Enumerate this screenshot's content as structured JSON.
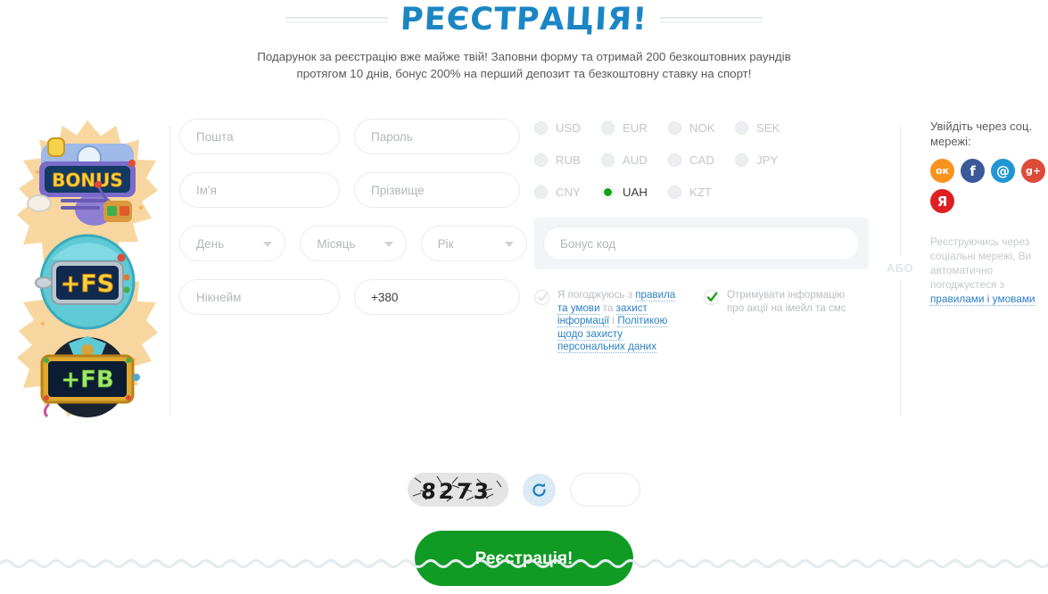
{
  "header": {
    "title": "РЕЄСТРАЦІЯ!",
    "subtitle": "Подарунок за реєстрацію вже майже твій! Заповни форму та отримай 200 безкоштовних раундів протягом 10 днів, бонус 200% на перший депозит та безкоштовну ставку на спорт!"
  },
  "promo": {
    "badges": [
      {
        "label": "BONUS"
      },
      {
        "label": "+FS"
      },
      {
        "label": "+FB"
      }
    ]
  },
  "form": {
    "email_placeholder": "Пошта",
    "password_placeholder": "Пароль",
    "firstname_placeholder": "Ім'я",
    "lastname_placeholder": "Прізвище",
    "day_placeholder": "День",
    "month_placeholder": "Місяць",
    "year_placeholder": "Рік",
    "nickname_placeholder": "Нікнейм",
    "phone_value": "+380"
  },
  "currency": {
    "rows": [
      [
        {
          "code": "USD",
          "selected": false
        },
        {
          "code": "EUR",
          "selected": false
        },
        {
          "code": "NOK",
          "selected": false
        },
        {
          "code": "SEK",
          "selected": false
        }
      ],
      [
        {
          "code": "RUB",
          "selected": false
        },
        {
          "code": "AUD",
          "selected": false
        },
        {
          "code": "CAD",
          "selected": false
        },
        {
          "code": "JPY",
          "selected": false
        }
      ],
      [
        {
          "code": "CNY",
          "selected": false
        },
        {
          "code": "UAH",
          "selected": true
        },
        {
          "code": "KZT",
          "selected": false
        }
      ]
    ],
    "selected": "UAH",
    "selected_color": "#14a014"
  },
  "bonus": {
    "placeholder": "Бонус код"
  },
  "agreements": [
    {
      "checked": false,
      "parts": [
        {
          "text": "Я погоджуюсь з ",
          "link": false
        },
        {
          "text": "правила та умови",
          "link": true
        },
        {
          "text": " та ",
          "link": false
        },
        {
          "text": "захист інформації",
          "link": true
        },
        {
          "text": " і ",
          "link": false
        },
        {
          "text": "Політикою щодо захисту персональних даних",
          "link": true
        }
      ]
    },
    {
      "checked": true,
      "parts": [
        {
          "text": "Отримувати інформацію про акції на імейл та смс",
          "link": false
        }
      ]
    }
  ],
  "divider": {
    "or_label": "АБО"
  },
  "social": {
    "title": "Увійдіть через соц. мережі:",
    "icons": [
      {
        "name": "odnoklassniki",
        "glyph": "ок",
        "color": "#F7931E"
      },
      {
        "name": "facebook",
        "glyph": "f",
        "color": "#3B5998"
      },
      {
        "name": "mailru",
        "glyph": "@",
        "color": "#2196D3"
      },
      {
        "name": "googleplus",
        "glyph": "g+",
        "color": "#DD4B39"
      },
      {
        "name": "yandex",
        "glyph": "Я",
        "color": "#E02020"
      }
    ],
    "note_parts": [
      {
        "text": "Реєструючись через соціальні мережі, Ви автоматично погоджуєтеся з ",
        "link": false
      },
      {
        "text": "правилами і умовами",
        "link": true
      }
    ]
  },
  "captcha": {
    "code": "8273",
    "refresh_icon": "refresh-icon",
    "input_value": ""
  },
  "submit": {
    "label": "Реєстрація!",
    "color": "#0f9b24"
  }
}
